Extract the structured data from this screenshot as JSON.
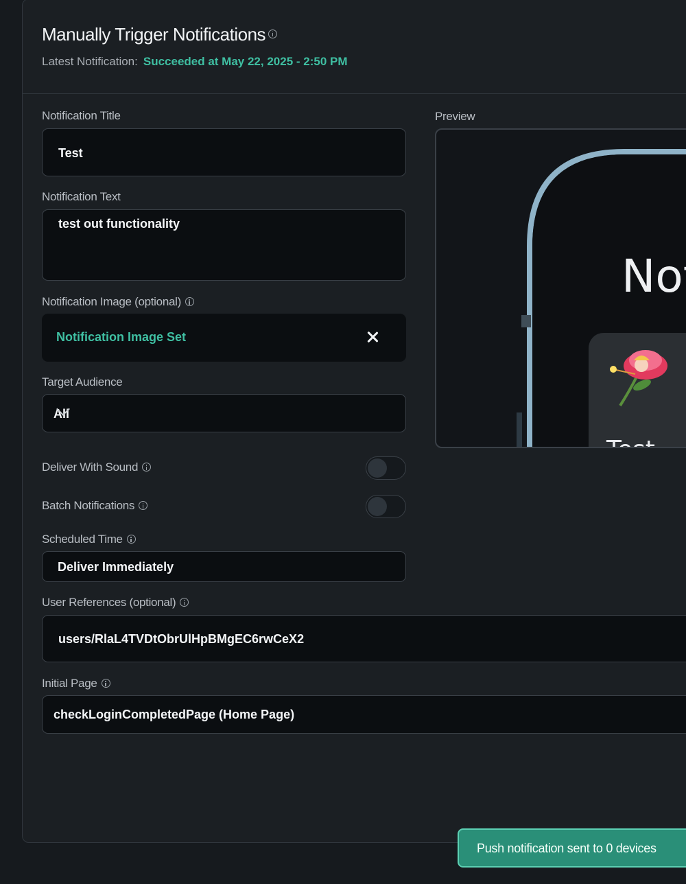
{
  "header": {
    "title": "Manually Trigger Notifications",
    "latest_label": "Latest Notification:",
    "latest_status": "Succeeded at May 22, 2025 - 2:50 PM"
  },
  "form": {
    "title_label": "Notification Title",
    "title_value": "Test",
    "text_label": "Notification Text",
    "text_value": "test out functionality",
    "image_label": "Notification Image (optional)",
    "image_status": "Notification Image Set",
    "audience_label": "Target Audience",
    "audience_value": "All",
    "sound_label": "Deliver With Sound",
    "sound_on": false,
    "batch_label": "Batch Notifications",
    "batch_on": false,
    "scheduled_label": "Scheduled Time",
    "scheduled_value": "Deliver Immediately",
    "user_refs_label": "User References (optional)",
    "user_refs_value": "users/RlaL4TVDtObrUlHpBMgEC6rwCeX2",
    "initial_page_label": "Initial Page",
    "initial_page_value": "checkLoginCompletedPage (Home Page)"
  },
  "preview": {
    "label": "Preview",
    "header_text": "Not",
    "notification_title": "Test"
  },
  "toast": {
    "message": "Push notification sent to 0 devices"
  },
  "colors": {
    "accent": "#3fbfa2",
    "toast_bg": "#2a8f78",
    "panel_bg": "#1b1f23",
    "input_bg": "#0b0e11"
  }
}
